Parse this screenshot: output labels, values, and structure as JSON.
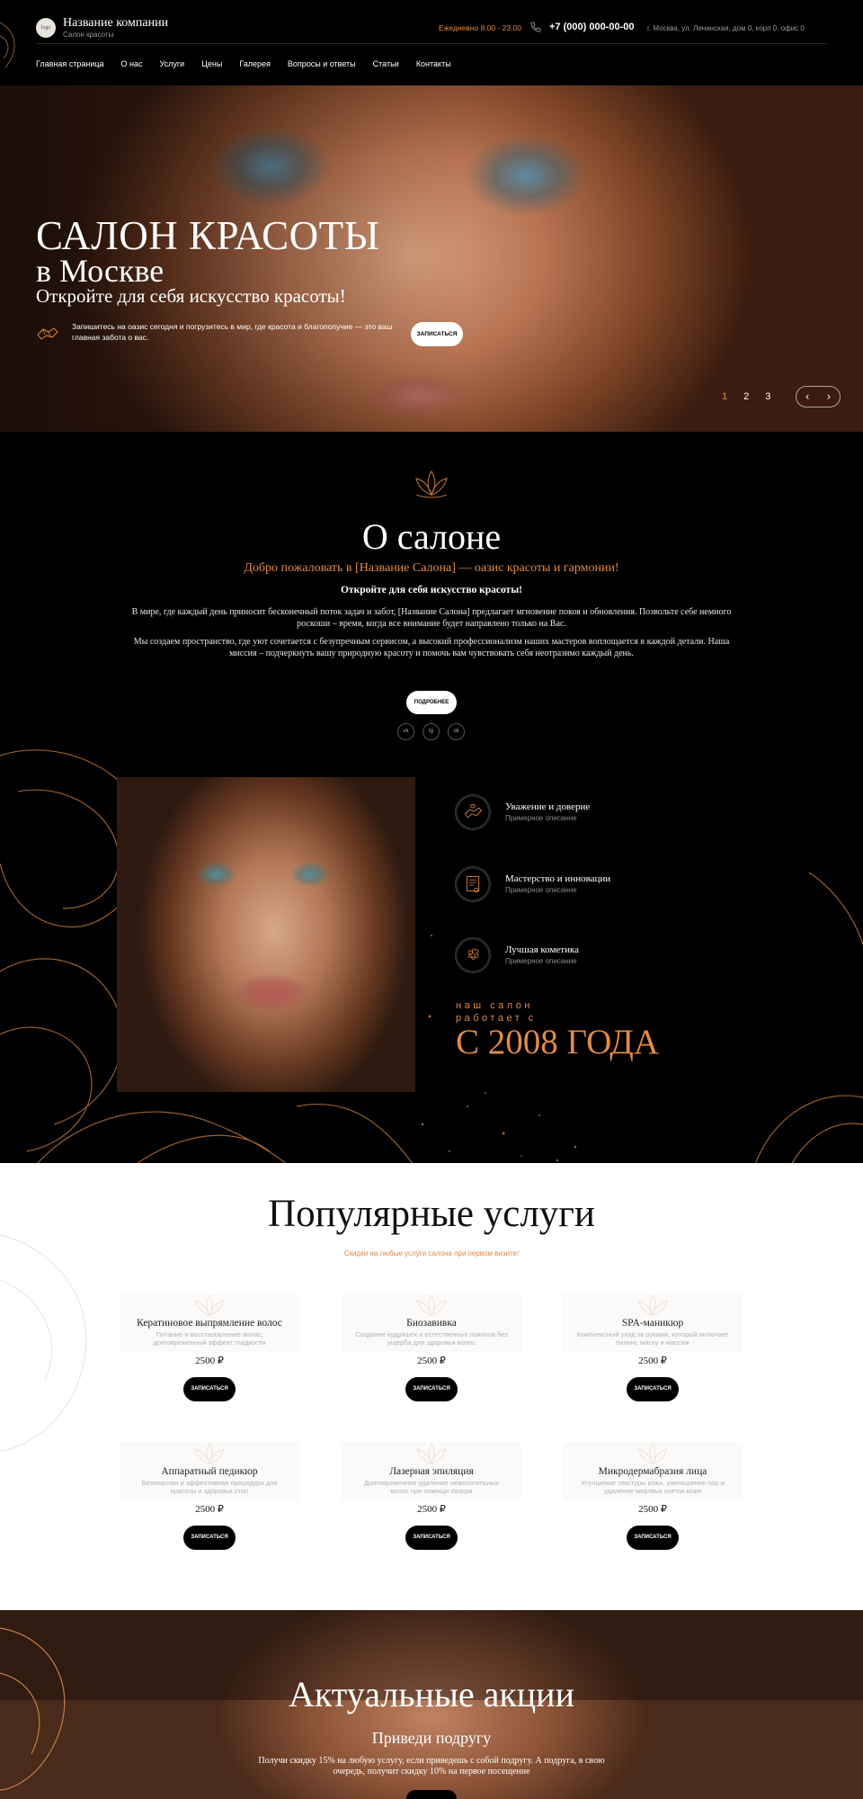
{
  "header": {
    "logo_text": "logo",
    "company_name": "Название компании",
    "company_sub": "Салон красоты",
    "hours": "Ежедневно 8.00 - 23.00",
    "phone": "+7 (000) 000-00-00",
    "address": "г. Москва, ул. Ленинская, дом 0, корп 0, офис 0"
  },
  "nav": [
    "Главная страница",
    "О нас",
    "Услуги",
    "Цены",
    "Галерея",
    "Вопросы и ответы",
    "Статьи",
    "Контакты"
  ],
  "hero": {
    "title_line1": "САЛОН КРАСОТЫ",
    "title_line2": "в Москве",
    "subtitle": "Откройте для себя искусство красоты!",
    "text": "Запишитесь на оазис сегодня и погрузитесь в мир, где красота и благополучие — это ваш главная забота о вас.",
    "button": "ЗАПИСАТЬСЯ",
    "pages": [
      "1",
      "2",
      "3"
    ],
    "prev": "‹",
    "next": "›"
  },
  "about": {
    "title": "О салоне",
    "welcome": "Добро пожаловать в [Название Салона] — оазис красоты и гармонии!",
    "discover": "Откройте для себя искусство красоты!",
    "p1": "В мире, где каждый день приносит бесконечный поток задач и забот, [Название Салона] предлагает мгновение покоя и обновления. Позвольте себе немного роскоши – время, когда все внимание будет направлено только на Вас.",
    "p2": "Мы создаем пространство, где уют сочетается с безупречным сервисом, а высокий профессионализм наших мастеров воплощается в каждой детали. Наша миссия – подчеркнуть вашу природную красоту и помочь вам чувствовать себя неотразимо каждый день.",
    "button": "ПОДРОБНЕЕ",
    "socials": [
      "vk",
      "tg",
      "ok"
    ]
  },
  "features": {
    "items": [
      {
        "title": "Уважение и доверие",
        "desc": "Примерное описание",
        "icon": "hands-heart-icon"
      },
      {
        "title": "Мастерство и инновации",
        "desc": "Примерное описание",
        "icon": "certificate-icon"
      },
      {
        "title": "Лучшая кометика",
        "desc": "Примерное описание",
        "icon": "flower-icon"
      }
    ],
    "since_line1": "наш салон",
    "since_line2": "работает с",
    "since_year": "С 2008 ГОДА"
  },
  "services": {
    "title": "Популярные услуги",
    "subtitle": "Скидки на любые услуги салона при первом визите!",
    "items": [
      {
        "title": "Кератиновое выпрямление волос",
        "desc": "Питание и восстановление волос, долговременный эффект гладкости",
        "price": "2500 ₽",
        "button": "ЗАПИСАТЬСЯ"
      },
      {
        "title": "Биозавивка",
        "desc": "Создание кудряшек и естественных локонов без ущерба для здоровья волос",
        "price": "2500 ₽",
        "button": "ЗАПИСАТЬСЯ"
      },
      {
        "title": "SPA-маникюр",
        "desc": "Комплексный уход за руками, который включает пилинг, маску и массаж",
        "price": "2500 ₽",
        "button": "ЗАПИСАТЬСЯ"
      },
      {
        "title": "Аппаратный педикюр",
        "desc": "Безопасная и эффективная процедура для красоты и здоровья стоп",
        "price": "2500 ₽",
        "button": "ЗАПИСАТЬСЯ"
      },
      {
        "title": "Лазерная эпиляция",
        "desc": "Долговременное удаление нежелательных волос при помощи лазера",
        "price": "2500 ₽",
        "button": "ЗАПИСАТЬСЯ"
      },
      {
        "title": "Микродермабразия лица",
        "desc": "Улучшение текстуры кожи, уменьшение пор и удаление мертвых клеток кожи",
        "price": "2500 ₽",
        "button": "ЗАПИСАТЬСЯ"
      }
    ]
  },
  "promos": {
    "title": "Актуальные акции",
    "promo_title": "Приведи подругу",
    "promo_text": "Получи скидку 15% на любую услугу, если приведешь с собой подругу. А подруга, в свою очередь, получит скидку 10% на первое посещение"
  },
  "colors": {
    "accent": "#e08a45",
    "background": "#000000",
    "light": "#ffffff"
  }
}
